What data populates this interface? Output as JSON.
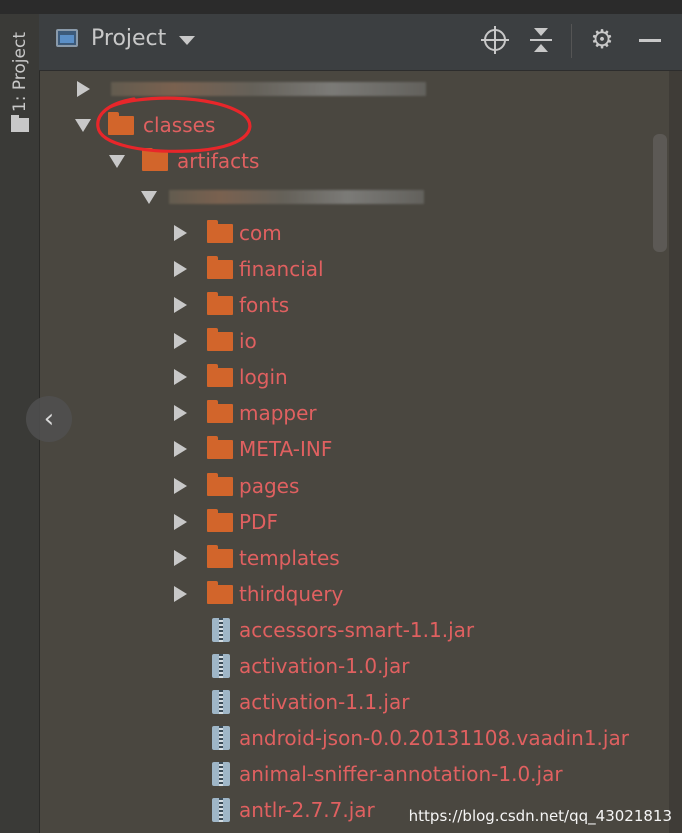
{
  "tool_window_tab": {
    "label": "1: Project"
  },
  "header": {
    "title": "Project"
  },
  "tree": {
    "classes": "classes",
    "artifacts": "artifacts",
    "folders": [
      "com",
      "financial",
      "fonts",
      "io",
      "login",
      "mapper",
      "META-INF",
      "pages",
      "PDF",
      "templates",
      "thirdquery"
    ],
    "jars": [
      "accessors-smart-1.1.jar",
      "activation-1.0.jar",
      "activation-1.1.jar",
      "android-json-0.0.20131108.vaadin1.jar",
      "animal-sniffer-annotation-1.0.jar",
      "antlr-2.7.7.jar"
    ]
  },
  "colors": {
    "label": "#e06060",
    "folder": "#d2652b",
    "annotation": "#e8262a"
  },
  "watermark": "https://blog.csdn.net/qq_43021813",
  "prev_icon": "‹"
}
